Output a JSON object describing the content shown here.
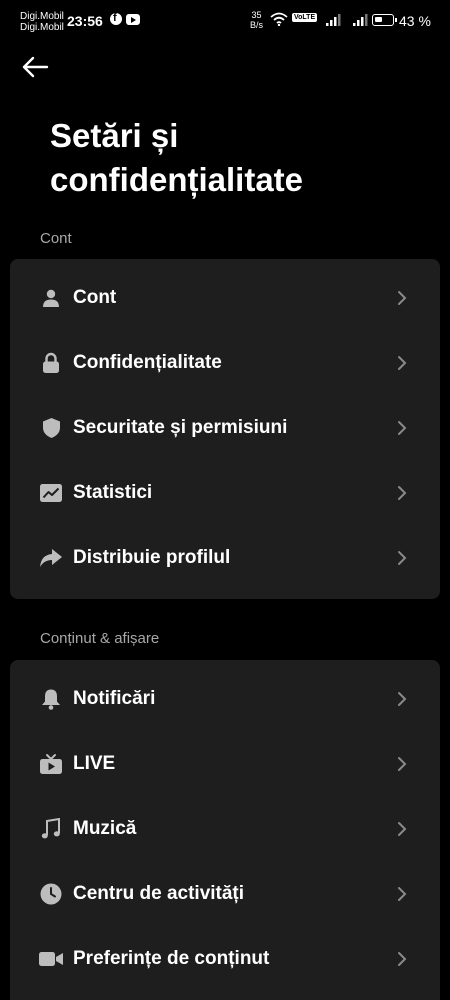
{
  "status_bar": {
    "carrier_1": "Digi.Mobil",
    "carrier_2": "Digi.Mobil",
    "time": "23:56",
    "net_speed_value": "35",
    "net_speed_unit": "B/s",
    "volte": "VoLTE",
    "battery": "43 %",
    "battery_level": 0.43
  },
  "header": {
    "title": "Setări și confidențialitate"
  },
  "sections": [
    {
      "title": "Cont",
      "items": [
        {
          "label": "Cont",
          "icon": "person-icon"
        },
        {
          "label": "Confidențialitate",
          "icon": "lock-icon"
        },
        {
          "label": "Securitate și permisiuni",
          "icon": "shield-icon"
        },
        {
          "label": "Statistici",
          "icon": "trend-chart-icon"
        },
        {
          "label": "Distribuie profilul",
          "icon": "share-arrow-icon"
        }
      ]
    },
    {
      "title": "Conținut & afișare",
      "items": [
        {
          "label": "Notificări",
          "icon": "bell-icon"
        },
        {
          "label": "LIVE",
          "icon": "tv-icon"
        },
        {
          "label": "Muzică",
          "icon": "music-note-icon"
        },
        {
          "label": "Centru de activități",
          "icon": "clock-icon"
        },
        {
          "label": "Preferințe de conținut",
          "icon": "video-camera-icon"
        }
      ]
    }
  ]
}
